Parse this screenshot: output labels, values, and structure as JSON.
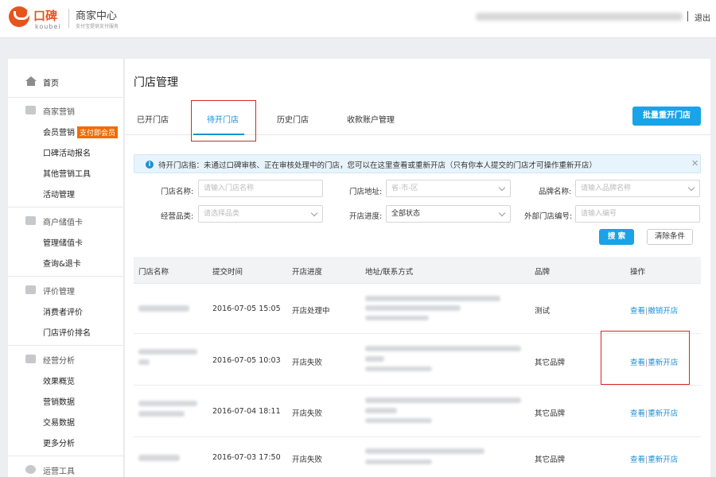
{
  "header": {
    "brand_cn": "口碑",
    "brand_en": "koubei",
    "center_title": "商家中心",
    "center_subtitle": "支付宝提供支付服务",
    "logout": "退出"
  },
  "sidebar": {
    "home": "首页",
    "groups": [
      {
        "title": "商家营销",
        "icon": "marketing-icon",
        "items": [
          {
            "label": "会员营销",
            "tag": "支付即会员"
          },
          {
            "label": "口碑活动报名"
          },
          {
            "label": "其他营销工具"
          },
          {
            "label": "活动管理"
          }
        ]
      },
      {
        "title": "商户储值卡",
        "icon": "card-icon",
        "items": [
          {
            "label": "管理储值卡"
          },
          {
            "label": "查询&退卡"
          }
        ]
      },
      {
        "title": "评价管理",
        "icon": "review-icon",
        "items": [
          {
            "label": "消费者评价"
          },
          {
            "label": "门店评价排名"
          }
        ]
      },
      {
        "title": "经营分析",
        "icon": "analytics-icon",
        "items": [
          {
            "label": "效果概览"
          },
          {
            "label": "营销数据"
          },
          {
            "label": "交易数据"
          },
          {
            "label": "更多分析"
          }
        ]
      },
      {
        "title": "运营工具",
        "icon": "tools-icon",
        "items": []
      }
    ]
  },
  "main": {
    "title": "门店管理",
    "tabs": [
      "已开门店",
      "待开门店",
      "历史门店",
      "收款账户管理"
    ],
    "active_tab": 1,
    "batch_button": "批量重开门店",
    "notice": "待开门店指：未通过口碑审核、正在审核处理中的门店，您可以在这里查看或重新开店（只有你本人提交的门店才可操作重新开店）",
    "filters": {
      "store_name_label": "门店名称:",
      "store_name_placeholder": "请输入门店名称",
      "address_label": "门店地址:",
      "address_placeholder": "省-市-区",
      "brand_label": "品牌名称:",
      "brand_placeholder": "请输入品牌名称",
      "category_label": "经营品类:",
      "category_placeholder": "请选择品类",
      "progress_label": "开店进度:",
      "progress_value": "全部状态",
      "external_id_label": "外部门店编号:",
      "external_id_placeholder": "请输入编号",
      "search_button": "搜 索",
      "clear_button": "清除条件"
    },
    "table": {
      "columns": [
        "门店名称",
        "提交时间",
        "开店进度",
        "地址/联系方式",
        "品牌",
        "操作"
      ],
      "rows": [
        {
          "time": "2016-07-05 15:05",
          "status": "开店处理中",
          "brand": "测试",
          "op1": "查看",
          "op2": "撤销开店"
        },
        {
          "time": "2016-07-05 10:03",
          "status": "开店失败",
          "brand": "其它品牌",
          "op1": "查看",
          "op2": "重新开店"
        },
        {
          "time": "2016-07-04 18:11",
          "status": "开店失败",
          "brand": "其它品牌",
          "op1": "查看",
          "op2": "重新开店"
        },
        {
          "time": "2016-07-03 17:50",
          "status": "开店失败",
          "brand": "其它品牌",
          "op1": "查看",
          "op2": "重新开店"
        }
      ]
    }
  },
  "colors": {
    "brand": "#e8541e",
    "accent": "#1a90d9",
    "highlight": "#d7262b",
    "tag": "#ef6c00"
  }
}
